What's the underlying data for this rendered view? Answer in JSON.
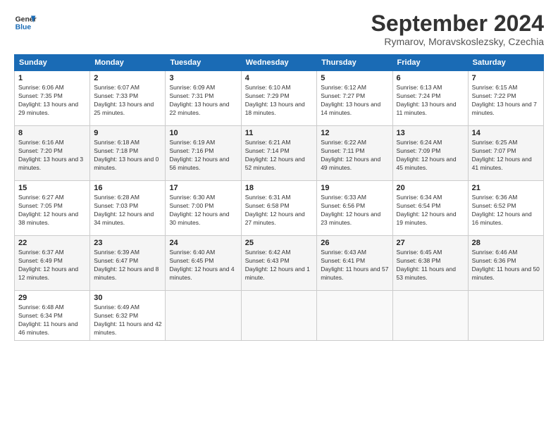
{
  "header": {
    "logo_line1": "General",
    "logo_line2": "Blue",
    "month_year": "September 2024",
    "location": "Rymarov, Moravskoslezsky, Czechia"
  },
  "columns": [
    "Sunday",
    "Monday",
    "Tuesday",
    "Wednesday",
    "Thursday",
    "Friday",
    "Saturday"
  ],
  "weeks": [
    [
      {
        "day": "1",
        "sunrise": "Sunrise: 6:06 AM",
        "sunset": "Sunset: 7:35 PM",
        "daylight": "Daylight: 13 hours and 29 minutes."
      },
      {
        "day": "2",
        "sunrise": "Sunrise: 6:07 AM",
        "sunset": "Sunset: 7:33 PM",
        "daylight": "Daylight: 13 hours and 25 minutes."
      },
      {
        "day": "3",
        "sunrise": "Sunrise: 6:09 AM",
        "sunset": "Sunset: 7:31 PM",
        "daylight": "Daylight: 13 hours and 22 minutes."
      },
      {
        "day": "4",
        "sunrise": "Sunrise: 6:10 AM",
        "sunset": "Sunset: 7:29 PM",
        "daylight": "Daylight: 13 hours and 18 minutes."
      },
      {
        "day": "5",
        "sunrise": "Sunrise: 6:12 AM",
        "sunset": "Sunset: 7:27 PM",
        "daylight": "Daylight: 13 hours and 14 minutes."
      },
      {
        "day": "6",
        "sunrise": "Sunrise: 6:13 AM",
        "sunset": "Sunset: 7:24 PM",
        "daylight": "Daylight: 13 hours and 11 minutes."
      },
      {
        "day": "7",
        "sunrise": "Sunrise: 6:15 AM",
        "sunset": "Sunset: 7:22 PM",
        "daylight": "Daylight: 13 hours and 7 minutes."
      }
    ],
    [
      {
        "day": "8",
        "sunrise": "Sunrise: 6:16 AM",
        "sunset": "Sunset: 7:20 PM",
        "daylight": "Daylight: 13 hours and 3 minutes."
      },
      {
        "day": "9",
        "sunrise": "Sunrise: 6:18 AM",
        "sunset": "Sunset: 7:18 PM",
        "daylight": "Daylight: 13 hours and 0 minutes."
      },
      {
        "day": "10",
        "sunrise": "Sunrise: 6:19 AM",
        "sunset": "Sunset: 7:16 PM",
        "daylight": "Daylight: 12 hours and 56 minutes."
      },
      {
        "day": "11",
        "sunrise": "Sunrise: 6:21 AM",
        "sunset": "Sunset: 7:14 PM",
        "daylight": "Daylight: 12 hours and 52 minutes."
      },
      {
        "day": "12",
        "sunrise": "Sunrise: 6:22 AM",
        "sunset": "Sunset: 7:11 PM",
        "daylight": "Daylight: 12 hours and 49 minutes."
      },
      {
        "day": "13",
        "sunrise": "Sunrise: 6:24 AM",
        "sunset": "Sunset: 7:09 PM",
        "daylight": "Daylight: 12 hours and 45 minutes."
      },
      {
        "day": "14",
        "sunrise": "Sunrise: 6:25 AM",
        "sunset": "Sunset: 7:07 PM",
        "daylight": "Daylight: 12 hours and 41 minutes."
      }
    ],
    [
      {
        "day": "15",
        "sunrise": "Sunrise: 6:27 AM",
        "sunset": "Sunset: 7:05 PM",
        "daylight": "Daylight: 12 hours and 38 minutes."
      },
      {
        "day": "16",
        "sunrise": "Sunrise: 6:28 AM",
        "sunset": "Sunset: 7:03 PM",
        "daylight": "Daylight: 12 hours and 34 minutes."
      },
      {
        "day": "17",
        "sunrise": "Sunrise: 6:30 AM",
        "sunset": "Sunset: 7:00 PM",
        "daylight": "Daylight: 12 hours and 30 minutes."
      },
      {
        "day": "18",
        "sunrise": "Sunrise: 6:31 AM",
        "sunset": "Sunset: 6:58 PM",
        "daylight": "Daylight: 12 hours and 27 minutes."
      },
      {
        "day": "19",
        "sunrise": "Sunrise: 6:33 AM",
        "sunset": "Sunset: 6:56 PM",
        "daylight": "Daylight: 12 hours and 23 minutes."
      },
      {
        "day": "20",
        "sunrise": "Sunrise: 6:34 AM",
        "sunset": "Sunset: 6:54 PM",
        "daylight": "Daylight: 12 hours and 19 minutes."
      },
      {
        "day": "21",
        "sunrise": "Sunrise: 6:36 AM",
        "sunset": "Sunset: 6:52 PM",
        "daylight": "Daylight: 12 hours and 16 minutes."
      }
    ],
    [
      {
        "day": "22",
        "sunrise": "Sunrise: 6:37 AM",
        "sunset": "Sunset: 6:49 PM",
        "daylight": "Daylight: 12 hours and 12 minutes."
      },
      {
        "day": "23",
        "sunrise": "Sunrise: 6:39 AM",
        "sunset": "Sunset: 6:47 PM",
        "daylight": "Daylight: 12 hours and 8 minutes."
      },
      {
        "day": "24",
        "sunrise": "Sunrise: 6:40 AM",
        "sunset": "Sunset: 6:45 PM",
        "daylight": "Daylight: 12 hours and 4 minutes."
      },
      {
        "day": "25",
        "sunrise": "Sunrise: 6:42 AM",
        "sunset": "Sunset: 6:43 PM",
        "daylight": "Daylight: 12 hours and 1 minute."
      },
      {
        "day": "26",
        "sunrise": "Sunrise: 6:43 AM",
        "sunset": "Sunset: 6:41 PM",
        "daylight": "Daylight: 11 hours and 57 minutes."
      },
      {
        "day": "27",
        "sunrise": "Sunrise: 6:45 AM",
        "sunset": "Sunset: 6:38 PM",
        "daylight": "Daylight: 11 hours and 53 minutes."
      },
      {
        "day": "28",
        "sunrise": "Sunrise: 6:46 AM",
        "sunset": "Sunset: 6:36 PM",
        "daylight": "Daylight: 11 hours and 50 minutes."
      }
    ],
    [
      {
        "day": "29",
        "sunrise": "Sunrise: 6:48 AM",
        "sunset": "Sunset: 6:34 PM",
        "daylight": "Daylight: 11 hours and 46 minutes."
      },
      {
        "day": "30",
        "sunrise": "Sunrise: 6:49 AM",
        "sunset": "Sunset: 6:32 PM",
        "daylight": "Daylight: 11 hours and 42 minutes."
      },
      null,
      null,
      null,
      null,
      null
    ]
  ]
}
